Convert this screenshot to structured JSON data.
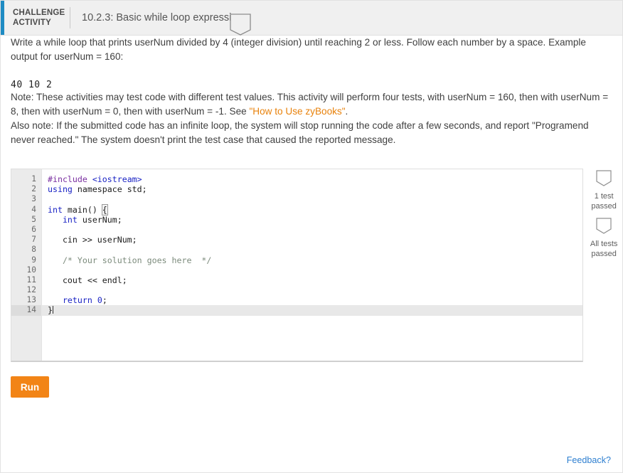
{
  "header": {
    "label_line1": "CHALLENGE",
    "label_line2": "ACTIVITY",
    "title": "10.2.3: Basic while loop expression.",
    "badge_icon": "pennant-icon",
    "accent_color": "#1e8bc3"
  },
  "instructions": {
    "paragraph_1": "Write a while loop that prints userNum divided by 4 (integer division) until reaching 2 or less. Follow each number by a space. Example output for userNum = 160:",
    "sample_output": "40 10 2",
    "note_prefix": "Note: These activities may test code with different test values. This activity will perform four tests, with userNum = 160, then with userNum = 8, then with userNum = 0, then with userNum = -1. See ",
    "note_link": "\"How to Use zyBooks\"",
    "note_suffix": ".",
    "also_note": "Also note: If the submitted code has an infinite loop, the system will stop running the code after a few seconds, and report \"Programend never reached.\" The system doesn't print the test case that caused the reported message.",
    "link_color": "#e8820c"
  },
  "editor": {
    "language": "cpp",
    "active_line": 14,
    "lines": [
      {
        "n": "1",
        "segments": [
          {
            "t": "#include ",
            "c": "tok-pre"
          },
          {
            "t": "<iostream>",
            "c": "tok-inc"
          }
        ]
      },
      {
        "n": "2",
        "segments": [
          {
            "t": "using ",
            "c": "tok-kw"
          },
          {
            "t": "namespace std;",
            "c": ""
          }
        ]
      },
      {
        "n": "3",
        "segments": [
          {
            "t": "",
            "c": ""
          }
        ]
      },
      {
        "n": "4",
        "segments": [
          {
            "t": "int ",
            "c": "tok-kw"
          },
          {
            "t": "main() ",
            "c": ""
          },
          {
            "t": "{",
            "c": "brace-match"
          }
        ]
      },
      {
        "n": "5",
        "segments": [
          {
            "t": "   ",
            "c": ""
          },
          {
            "t": "int ",
            "c": "tok-kw"
          },
          {
            "t": "userNum;",
            "c": ""
          }
        ]
      },
      {
        "n": "6",
        "segments": [
          {
            "t": "",
            "c": ""
          }
        ]
      },
      {
        "n": "7",
        "segments": [
          {
            "t": "   cin >> userNum;",
            "c": ""
          }
        ]
      },
      {
        "n": "8",
        "segments": [
          {
            "t": "",
            "c": ""
          }
        ]
      },
      {
        "n": "9",
        "segments": [
          {
            "t": "   ",
            "c": ""
          },
          {
            "t": "/* Your solution goes here  */",
            "c": "tok-cmt"
          }
        ]
      },
      {
        "n": "10",
        "segments": [
          {
            "t": "",
            "c": ""
          }
        ]
      },
      {
        "n": "11",
        "segments": [
          {
            "t": "   cout << endl;",
            "c": ""
          }
        ]
      },
      {
        "n": "12",
        "segments": [
          {
            "t": "",
            "c": ""
          }
        ]
      },
      {
        "n": "13",
        "segments": [
          {
            "t": "   ",
            "c": ""
          },
          {
            "t": "return ",
            "c": "tok-kw"
          },
          {
            "t": "0",
            "c": "tok-num"
          },
          {
            "t": ";",
            "c": ""
          }
        ]
      },
      {
        "n": "14",
        "segments": [
          {
            "t": "}",
            "c": ""
          }
        ]
      }
    ]
  },
  "test_panel": {
    "items": [
      {
        "icon": "pennant-icon",
        "label_line1": "1 test",
        "label_line2": "passed"
      },
      {
        "icon": "pennant-icon",
        "label_line1": "All tests",
        "label_line2": "passed"
      }
    ]
  },
  "actions": {
    "run_label": "Run",
    "run_color": "#f28416",
    "feedback_label": "Feedback?",
    "feedback_color": "#2e7fd0"
  }
}
